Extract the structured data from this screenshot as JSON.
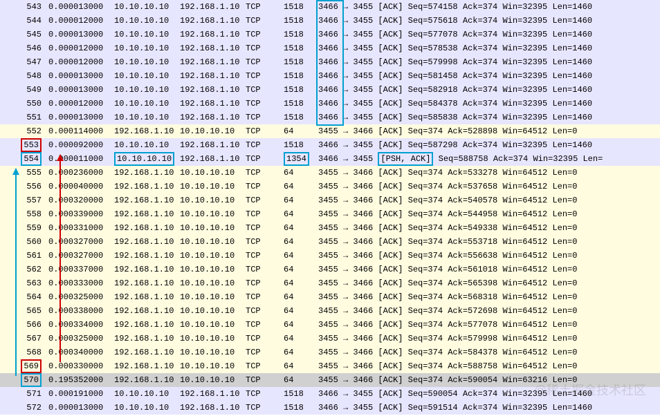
{
  "packets": [
    {
      "no": 543,
      "time": "0.000013000",
      "src": "10.10.10.10",
      "dst": "192.168.1.10",
      "proto": "TCP",
      "len": 1518,
      "info": "3466 → 3455 [ACK] Seq=574158 Ack=374 Win=32395 Len=1460",
      "dir": "out",
      "lenBox": "tall"
    },
    {
      "no": 544,
      "time": "0.000012000",
      "src": "10.10.10.10",
      "dst": "192.168.1.10",
      "proto": "TCP",
      "len": 1518,
      "info": "3466 → 3455 [ACK] Seq=575618 Ack=374 Win=32395 Len=1460",
      "dir": "out",
      "lenBox": "tall"
    },
    {
      "no": 545,
      "time": "0.000013000",
      "src": "10.10.10.10",
      "dst": "192.168.1.10",
      "proto": "TCP",
      "len": 1518,
      "info": "3466 → 3455 [ACK] Seq=577078 Ack=374 Win=32395 Len=1460",
      "dir": "out",
      "lenBox": "tall"
    },
    {
      "no": 546,
      "time": "0.000012000",
      "src": "10.10.10.10",
      "dst": "192.168.1.10",
      "proto": "TCP",
      "len": 1518,
      "info": "3466 → 3455 [ACK] Seq=578538 Ack=374 Win=32395 Len=1460",
      "dir": "out",
      "lenBox": "tall"
    },
    {
      "no": 547,
      "time": "0.000012000",
      "src": "10.10.10.10",
      "dst": "192.168.1.10",
      "proto": "TCP",
      "len": 1518,
      "info": "3466 → 3455 [ACK] Seq=579998 Ack=374 Win=32395 Len=1460",
      "dir": "out",
      "lenBox": "tall"
    },
    {
      "no": 548,
      "time": "0.000013000",
      "src": "10.10.10.10",
      "dst": "192.168.1.10",
      "proto": "TCP",
      "len": 1518,
      "info": "3466 → 3455 [ACK] Seq=581458 Ack=374 Win=32395 Len=1460",
      "dir": "out",
      "lenBox": "tall"
    },
    {
      "no": 549,
      "time": "0.000013000",
      "src": "10.10.10.10",
      "dst": "192.168.1.10",
      "proto": "TCP",
      "len": 1518,
      "info": "3466 → 3455 [ACK] Seq=582918 Ack=374 Win=32395 Len=1460",
      "dir": "out",
      "lenBox": "tall"
    },
    {
      "no": 550,
      "time": "0.000012000",
      "src": "10.10.10.10",
      "dst": "192.168.1.10",
      "proto": "TCP",
      "len": 1518,
      "info": "3466 → 3455 [ACK] Seq=584378 Ack=374 Win=32395 Len=1460",
      "dir": "out",
      "lenBox": "tall"
    },
    {
      "no": 551,
      "time": "0.000013000",
      "src": "10.10.10.10",
      "dst": "192.168.1.10",
      "proto": "TCP",
      "len": 1518,
      "info": "3466 → 3455 [ACK] Seq=585838 Ack=374 Win=32395 Len=1460",
      "dir": "out",
      "lenBox": "tall"
    },
    {
      "no": 552,
      "time": "0.000114000",
      "src": "192.168.1.10",
      "dst": "10.10.10.10",
      "proto": "TCP",
      "len": 64,
      "info": "3455 → 3466 [ACK] Seq=374 Ack=528898 Win=64512 Len=0",
      "dir": "in"
    },
    {
      "no": 553,
      "time": "0.000092000",
      "src": "10.10.10.10",
      "dst": "192.168.1.10",
      "proto": "TCP",
      "len": 1518,
      "info": "3466 → 3455 [ACK] Seq=587298 Ack=374 Win=32395 Len=1460",
      "dir": "out",
      "noBox": "red"
    },
    {
      "no": 554,
      "time": "0.000011000",
      "src": "10.10.10.10",
      "dst": "192.168.1.10",
      "proto": "TCP",
      "len": 1354,
      "info": "3466 → 3455 [PSH, ACK] Seq=588758 Ack=374 Win=32395 Len=",
      "dir": "out",
      "noBox": "cyan",
      "srcBox": "cyan",
      "lenBox": "cyan",
      "flagBox": "cyan",
      "flagText": "[PSH, ACK]",
      "infoPrefix": "3466 → 3455 ",
      "infoSuffix": " Seq=588758 Ack=374 Win=32395 Len="
    },
    {
      "no": 555,
      "time": "0.000236000",
      "src": "192.168.1.10",
      "dst": "10.10.10.10",
      "proto": "TCP",
      "len": 64,
      "info": "3455 → 3466 [ACK] Seq=374 Ack=533278 Win=64512 Len=0",
      "dir": "in"
    },
    {
      "no": 556,
      "time": "0.000040000",
      "src": "192.168.1.10",
      "dst": "10.10.10.10",
      "proto": "TCP",
      "len": 64,
      "info": "3455 → 3466 [ACK] Seq=374 Ack=537658 Win=64512 Len=0",
      "dir": "in"
    },
    {
      "no": 557,
      "time": "0.000320000",
      "src": "192.168.1.10",
      "dst": "10.10.10.10",
      "proto": "TCP",
      "len": 64,
      "info": "3455 → 3466 [ACK] Seq=374 Ack=540578 Win=64512 Len=0",
      "dir": "in"
    },
    {
      "no": 558,
      "time": "0.000339000",
      "src": "192.168.1.10",
      "dst": "10.10.10.10",
      "proto": "TCP",
      "len": 64,
      "info": "3455 → 3466 [ACK] Seq=374 Ack=544958 Win=64512 Len=0",
      "dir": "in"
    },
    {
      "no": 559,
      "time": "0.000331000",
      "src": "192.168.1.10",
      "dst": "10.10.10.10",
      "proto": "TCP",
      "len": 64,
      "info": "3455 → 3466 [ACK] Seq=374 Ack=549338 Win=64512 Len=0",
      "dir": "in"
    },
    {
      "no": 560,
      "time": "0.000327000",
      "src": "192.168.1.10",
      "dst": "10.10.10.10",
      "proto": "TCP",
      "len": 64,
      "info": "3455 → 3466 [ACK] Seq=374 Ack=553718 Win=64512 Len=0",
      "dir": "in"
    },
    {
      "no": 561,
      "time": "0.000327000",
      "src": "192.168.1.10",
      "dst": "10.10.10.10",
      "proto": "TCP",
      "len": 64,
      "info": "3455 → 3466 [ACK] Seq=374 Ack=556638 Win=64512 Len=0",
      "dir": "in"
    },
    {
      "no": 562,
      "time": "0.000337000",
      "src": "192.168.1.10",
      "dst": "10.10.10.10",
      "proto": "TCP",
      "len": 64,
      "info": "3455 → 3466 [ACK] Seq=374 Ack=561018 Win=64512 Len=0",
      "dir": "in"
    },
    {
      "no": 563,
      "time": "0.000333000",
      "src": "192.168.1.10",
      "dst": "10.10.10.10",
      "proto": "TCP",
      "len": 64,
      "info": "3455 → 3466 [ACK] Seq=374 Ack=565398 Win=64512 Len=0",
      "dir": "in"
    },
    {
      "no": 564,
      "time": "0.000325000",
      "src": "192.168.1.10",
      "dst": "10.10.10.10",
      "proto": "TCP",
      "len": 64,
      "info": "3455 → 3466 [ACK] Seq=374 Ack=568318 Win=64512 Len=0",
      "dir": "in"
    },
    {
      "no": 565,
      "time": "0.000338000",
      "src": "192.168.1.10",
      "dst": "10.10.10.10",
      "proto": "TCP",
      "len": 64,
      "info": "3455 → 3466 [ACK] Seq=374 Ack=572698 Win=64512 Len=0",
      "dir": "in"
    },
    {
      "no": 566,
      "time": "0.000334000",
      "src": "192.168.1.10",
      "dst": "10.10.10.10",
      "proto": "TCP",
      "len": 64,
      "info": "3455 → 3466 [ACK] Seq=374 Ack=577078 Win=64512 Len=0",
      "dir": "in"
    },
    {
      "no": 567,
      "time": "0.000325000",
      "src": "192.168.1.10",
      "dst": "10.10.10.10",
      "proto": "TCP",
      "len": 64,
      "info": "3455 → 3466 [ACK] Seq=374 Ack=579998 Win=64512 Len=0",
      "dir": "in"
    },
    {
      "no": 568,
      "time": "0.000340000",
      "src": "192.168.1.10",
      "dst": "10.10.10.10",
      "proto": "TCP",
      "len": 64,
      "info": "3455 → 3466 [ACK] Seq=374 Ack=584378 Win=64512 Len=0",
      "dir": "in"
    },
    {
      "no": 569,
      "time": "0.000330000",
      "src": "192.168.1.10",
      "dst": "10.10.10.10",
      "proto": "TCP",
      "len": 64,
      "info": "3455 → 3466 [ACK] Seq=374 Ack=588758 Win=64512 Len=0",
      "dir": "in",
      "noBox": "red"
    },
    {
      "no": 570,
      "time": "0.195352000",
      "src": "192.168.1.10",
      "dst": "10.10.10.10",
      "proto": "TCP",
      "len": 64,
      "info": "3455 → 3466 [ACK] Seq=374 Ack=590054 Win=63216 Len=0",
      "dir": "in",
      "noBox": "cyan",
      "sel": true
    },
    {
      "no": 571,
      "time": "0.000191000",
      "src": "10.10.10.10",
      "dst": "192.168.1.10",
      "proto": "TCP",
      "len": 1518,
      "info": "3466 → 3455 [ACK] Seq=590054 Ack=374 Win=32395 Len=1460",
      "dir": "out"
    },
    {
      "no": 572,
      "time": "0.000013000",
      "src": "10.10.10.10",
      "dst": "192.168.1.10",
      "proto": "TCP",
      "len": 1518,
      "info": "3466 → 3455 [ACK] Seq=591514 Ack=374 Win=32395 Len=1460",
      "dir": "out"
    }
  ],
  "watermark": "@稀土掘金技术社区"
}
